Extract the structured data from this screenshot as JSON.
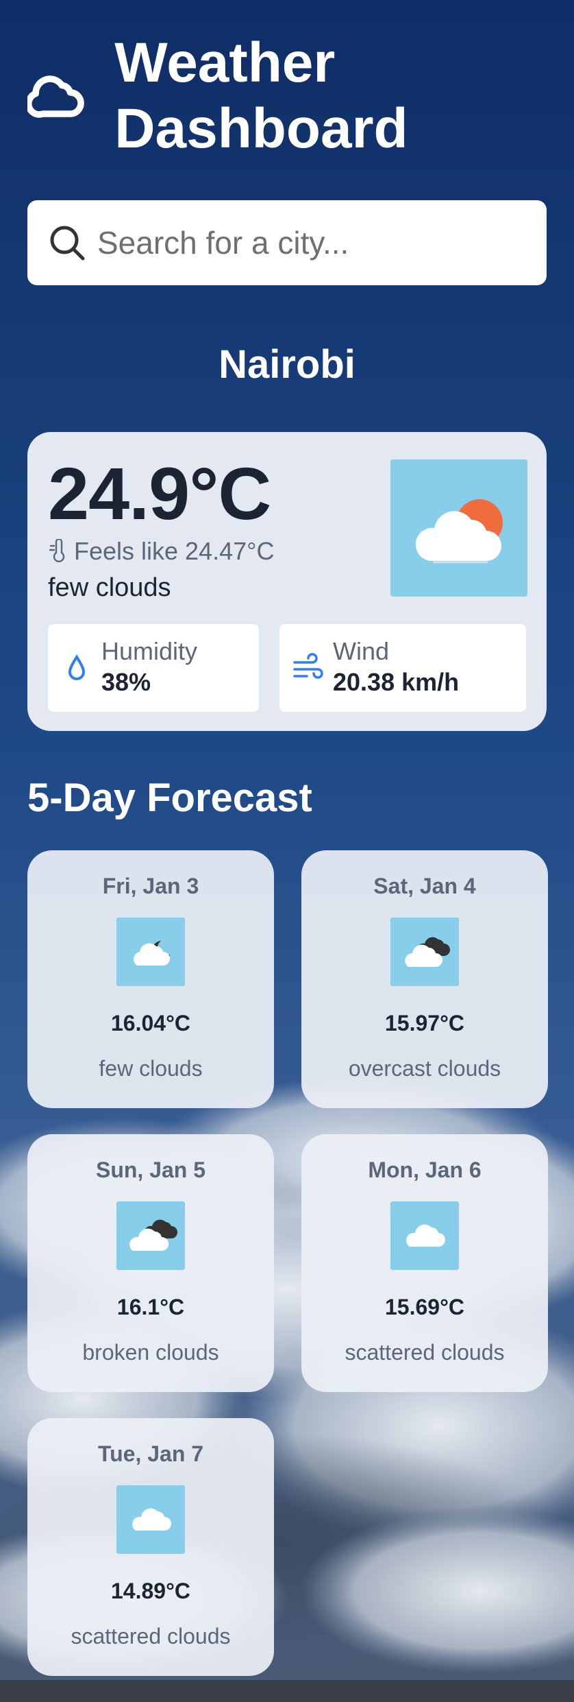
{
  "header": {
    "title": "Weather Dashboard"
  },
  "search": {
    "placeholder": "Search for a city..."
  },
  "current": {
    "city": "Nairobi",
    "temperature": "24.9°C",
    "feels_like": "Feels like 24.47°C",
    "description": "few clouds",
    "icon": "partly-cloudy-sun-icon",
    "humidity": {
      "label": "Humidity",
      "value": "38%"
    },
    "wind": {
      "label": "Wind",
      "value": "20.38 km/h"
    }
  },
  "forecast": {
    "title": "5-Day Forecast",
    "days": [
      {
        "day": "Fri, Jan 3",
        "temp": "16.04°C",
        "desc": "few clouds",
        "icon": "cloud-night-icon"
      },
      {
        "day": "Sat, Jan 4",
        "temp": "15.97°C",
        "desc": "overcast clouds",
        "icon": "overcast-clouds-icon"
      },
      {
        "day": "Sun, Jan 5",
        "temp": "16.1°C",
        "desc": "broken clouds",
        "icon": "broken-clouds-icon"
      },
      {
        "day": "Mon, Jan 6",
        "temp": "15.69°C",
        "desc": "scattered clouds",
        "icon": "cloud-icon"
      },
      {
        "day": "Tue, Jan 7",
        "temp": "14.89°C",
        "desc": "scattered clouds",
        "icon": "cloud-icon"
      }
    ]
  },
  "colors": {
    "sky_top": "#0f2d66",
    "sky_bottom": "#2a5a9a",
    "accent_sun": "#ef6c3c",
    "icon_bg": "#87ceeb",
    "card_bg": "#eceff5",
    "humidity_icon": "#2f80ed",
    "wind_icon": "#2f80ed"
  }
}
